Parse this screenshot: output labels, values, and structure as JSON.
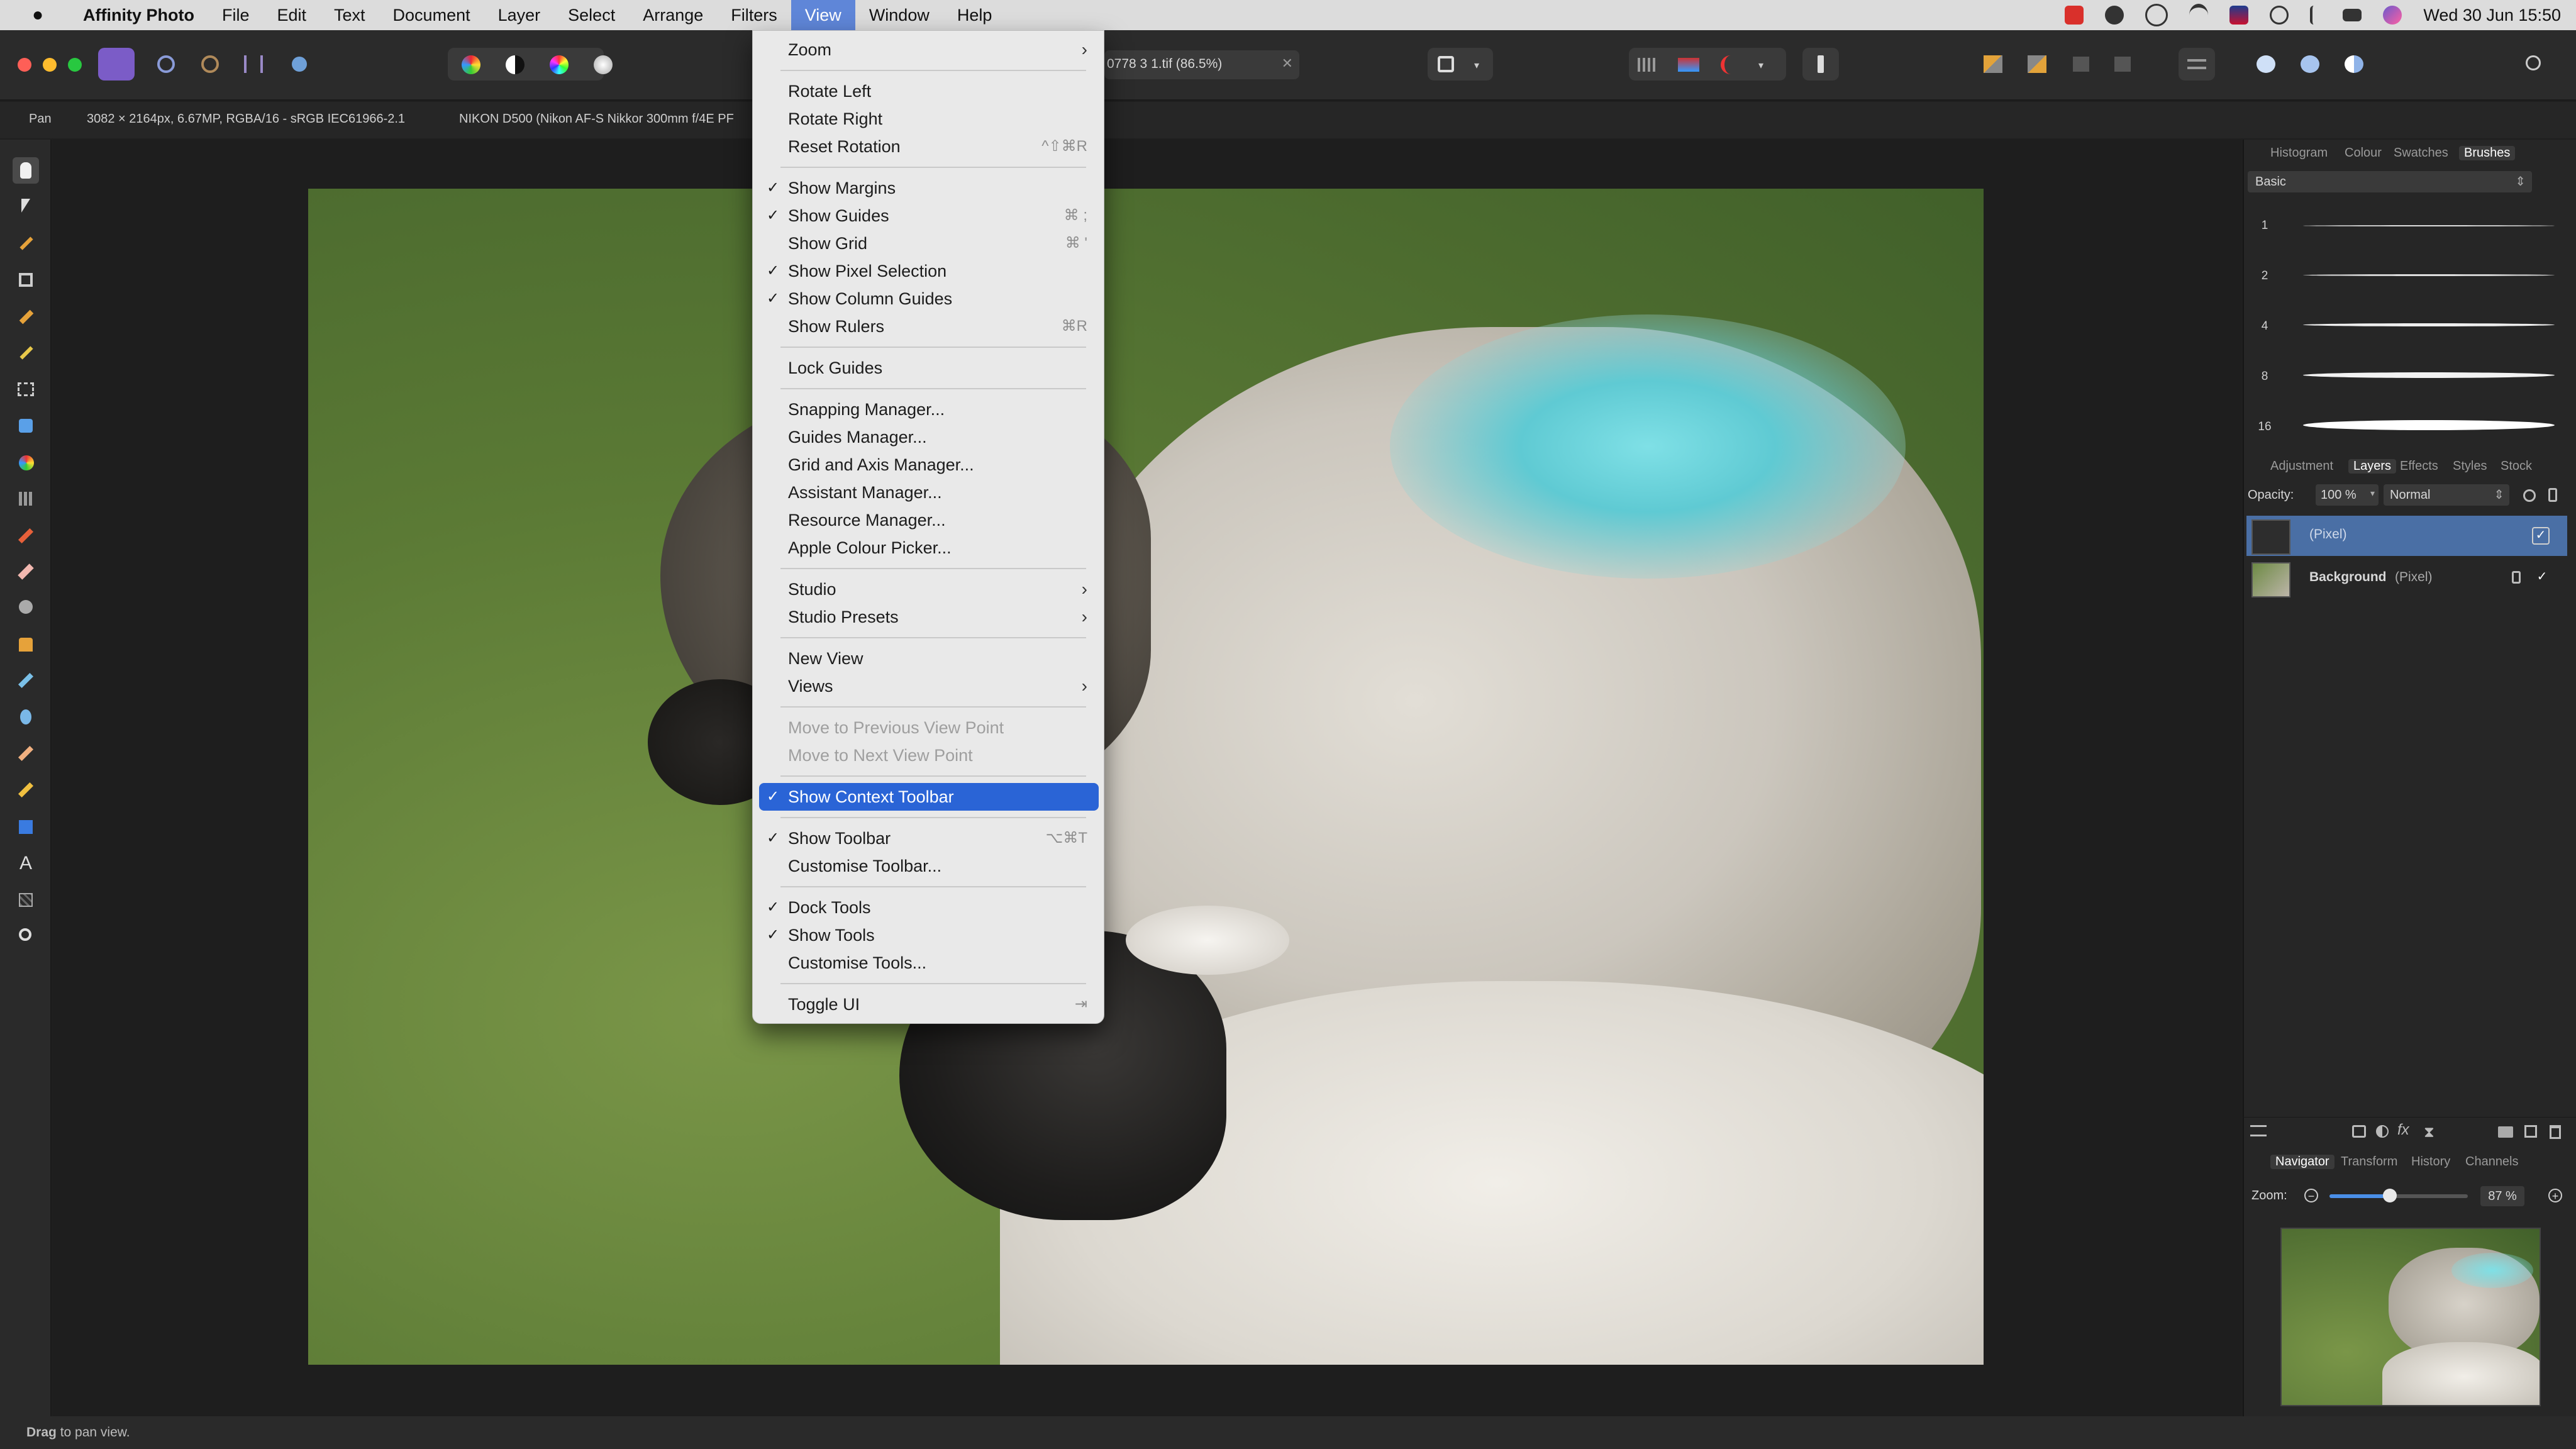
{
  "menubar": {
    "app_name": "Affinity Photo",
    "items": [
      "File",
      "Edit",
      "Text",
      "Document",
      "Layer",
      "Select",
      "Arrange",
      "Filters",
      "View",
      "Window",
      "Help"
    ],
    "datetime": "Wed 30 Jun  15:50"
  },
  "toolbar": {
    "document_name": "0778 3 1.tif (86.5%)"
  },
  "context_bar": {
    "tool_name": "Pan",
    "doc_info": "3082 × 2164px, 6.67MP, RGBA/16 - sRGB IEC61966-2.1",
    "camera_info": "NIKON D500 (Nikon AF-S Nikkor 300mm f/4E PF"
  },
  "view_menu": {
    "items": [
      {
        "label": "Zoom",
        "submenu": true
      },
      {
        "label": "Rotate Left"
      },
      {
        "label": "Rotate Right"
      },
      {
        "label": "Reset Rotation",
        "shortcut": "^⇧⌘R"
      },
      {
        "label": "Show Margins",
        "checked": true
      },
      {
        "label": "Show Guides",
        "checked": true,
        "shortcut": "⌘ ;"
      },
      {
        "label": "Show Grid",
        "shortcut": "⌘ '"
      },
      {
        "label": "Show Pixel Selection",
        "checked": true
      },
      {
        "label": "Show Column Guides",
        "checked": true
      },
      {
        "label": "Show Rulers",
        "shortcut": "⌘R"
      },
      {
        "label": "Lock Guides"
      },
      {
        "label": "Snapping Manager..."
      },
      {
        "label": "Guides Manager..."
      },
      {
        "label": "Grid and Axis Manager..."
      },
      {
        "label": "Assistant Manager..."
      },
      {
        "label": "Resource Manager..."
      },
      {
        "label": "Apple Colour Picker..."
      },
      {
        "label": "Studio",
        "submenu": true
      },
      {
        "label": "Studio Presets",
        "submenu": true
      },
      {
        "label": "New View"
      },
      {
        "label": "Views",
        "submenu": true
      },
      {
        "label": "Move to Previous View Point",
        "disabled": true
      },
      {
        "label": "Move to Next View Point",
        "disabled": true
      },
      {
        "label": "Show Context Toolbar",
        "checked": true,
        "selected": true
      },
      {
        "label": "Show Toolbar",
        "checked": true,
        "shortcut": "⌥⌘T"
      },
      {
        "label": "Customise Toolbar..."
      },
      {
        "label": "Dock Tools",
        "checked": true
      },
      {
        "label": "Show Tools",
        "checked": true
      },
      {
        "label": "Customise Tools..."
      },
      {
        "label": "Toggle UI",
        "shortcut": "⇥"
      }
    ]
  },
  "right_panel": {
    "top_tabs": [
      "Histogram",
      "Colour",
      "Swatches",
      "Brushes"
    ],
    "brush_category": "Basic",
    "brush_sizes": [
      "1",
      "2",
      "4",
      "8",
      "16"
    ],
    "mid_tabs": [
      "Adjustment",
      "Layers",
      "Effects",
      "Styles",
      "Stock"
    ],
    "opacity_label": "Opacity:",
    "opacity_value": "100 %",
    "blend_mode": "Normal",
    "layers": [
      {
        "name": "(Pixel)",
        "selected": true
      },
      {
        "name": "Background",
        "type": "(Pixel)",
        "locked": true
      }
    ],
    "bottom_tabs": [
      "Navigator",
      "Transform",
      "History",
      "Channels"
    ],
    "zoom_label": "Zoom:",
    "zoom_value": "87 %",
    "zoom_level": 0.87
  },
  "status_bar": {
    "bold": "Drag",
    "text": " to pan view."
  },
  "colors": {
    "menu_highlight": "#2a64d6",
    "layer_selected": "#4a6fa5",
    "close": "#fe5f57",
    "minimize": "#febc2e",
    "zoom": "#28c840"
  }
}
